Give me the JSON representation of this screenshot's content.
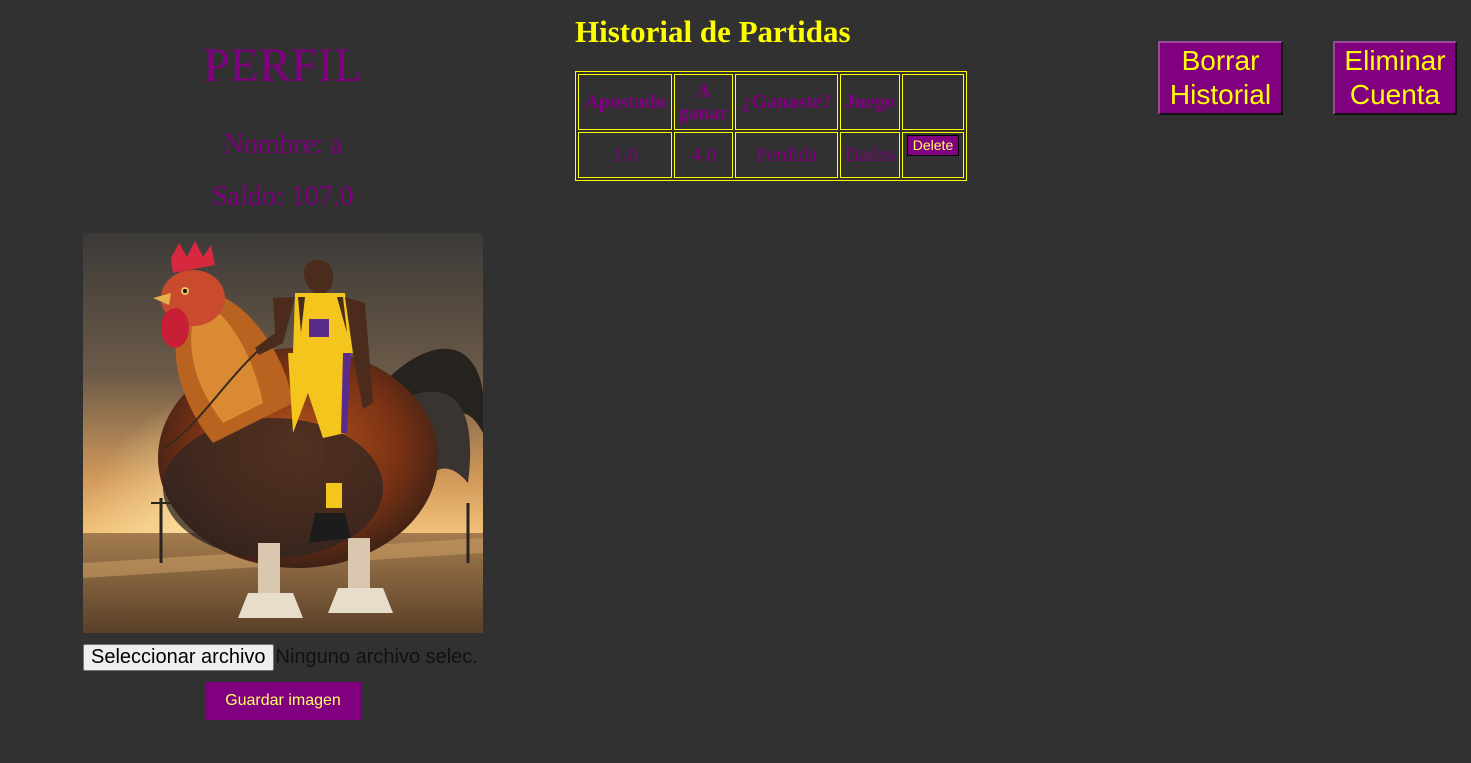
{
  "profile": {
    "title": "PERFIL",
    "name_text": "Nombre: a",
    "balance_text": "Saldo: 107.0",
    "file_button_label": "Seleccionar archivo",
    "file_status": "Ninguno archivo selec.",
    "save_button_label": "Guardar imagen"
  },
  "history": {
    "title": "Historial de Partidas",
    "headers": [
      "Apostado",
      "A ganar",
      "¿Ganaste?",
      "Juego",
      ""
    ],
    "rows": [
      {
        "bet": "1.0",
        "to_win": "4.0",
        "won": "Perdida",
        "game": "Dados",
        "delete_label": "Delete"
      }
    ]
  },
  "actions": {
    "clear_history_line1": "Borrar",
    "clear_history_line2": "Historial",
    "delete_account_line1": "Eliminar",
    "delete_account_line2": "Cuenta"
  },
  "colors": {
    "background": "#313131",
    "accent": "#800080",
    "highlight": "#ffff00"
  }
}
